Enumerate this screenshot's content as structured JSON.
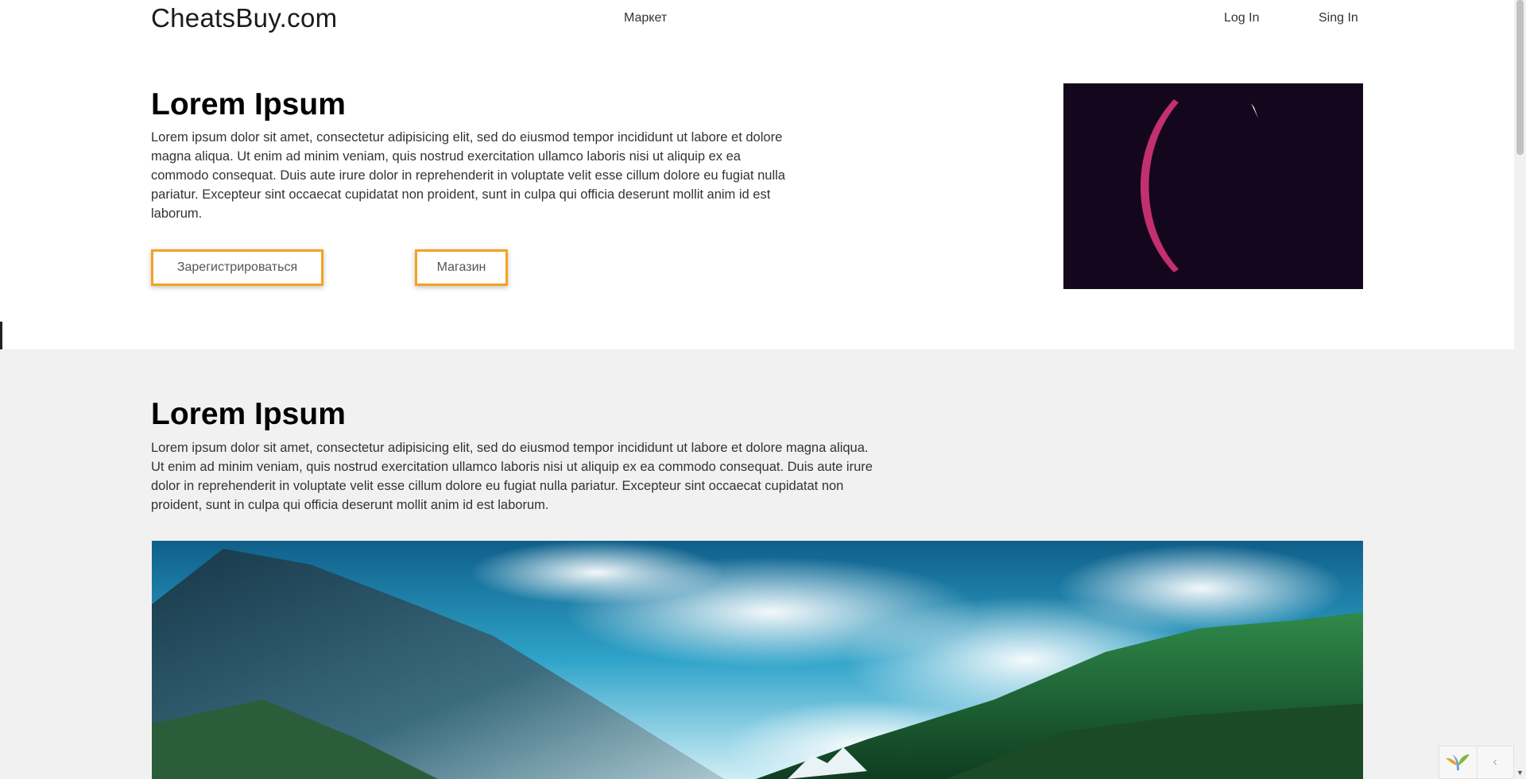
{
  "header": {
    "logo": "CheatsBuy.com",
    "nav": {
      "market": "Маркет",
      "login": "Log In",
      "signin": "Sing In"
    }
  },
  "hero": {
    "title": "Lorem Ipsum",
    "text": "Lorem ipsum dolor sit amet, consectetur adipisicing elit, sed do eiusmod tempor incididunt ut labore et dolore magna aliqua. Ut enim ad minim veniam, quis nostrud exercitation ullamco laboris nisi ut aliquip ex ea commodo consequat. Duis aute irure dolor in reprehenderit in voluptate velit esse cillum dolore eu fugiat nulla pariatur. Excepteur sint occaecat cupidatat non proident, sunt in culpa qui officia deserunt mollit anim id est laborum.",
    "buttons": {
      "register": "Зарегистрироваться",
      "shop": "Магазин"
    },
    "accent_color": "#f4a21f",
    "media_background": "#13061d"
  },
  "section2": {
    "title": "Lorem Ipsum",
    "text": "Lorem ipsum dolor sit amet, consectetur adipisicing elit, sed do eiusmod tempor incididunt ut labore et dolore magna aliqua. Ut enim ad minim veniam, quis nostrud exercitation ullamco laboris nisi ut aliquip ex ea commodo consequat. Duis aute irure dolor in reprehenderit in voluptate velit esse cillum dolore eu fugiat nulla pariatur. Excepteur sint occaecat cupidatat non proident, sunt in culpa qui officia deserunt mollit anim id est laborum.",
    "background": "#f1f1f1"
  },
  "widget": {
    "toggle_icon": "chevron-left-icon"
  }
}
